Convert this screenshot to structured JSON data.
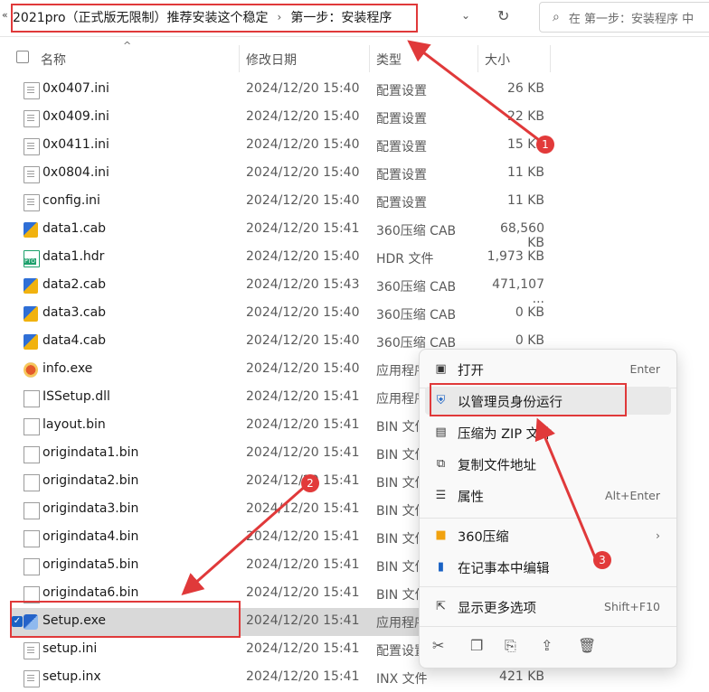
{
  "address": {
    "back_chevron": "«",
    "path": [
      "2021pro（正式版无限制）推荐安装这个稳定",
      "第一步：安装程序"
    ],
    "separator": "›",
    "dropdown": "⌄",
    "refresh": "↻",
    "search_placeholder": "在 第一步：安装程序 中"
  },
  "columns": {
    "name": "名称",
    "date": "修改日期",
    "type": "类型",
    "size": "大小"
  },
  "files": [
    {
      "name": "0x0407.ini",
      "date": "2024/12/20 15:40",
      "type": "配置设置",
      "size": "26 KB",
      "icon": "ini"
    },
    {
      "name": "0x0409.ini",
      "date": "2024/12/20 15:40",
      "type": "配置设置",
      "size": "22 KB",
      "icon": "ini"
    },
    {
      "name": "0x0411.ini",
      "date": "2024/12/20 15:40",
      "type": "配置设置",
      "size": "15 KB",
      "icon": "ini"
    },
    {
      "name": "0x0804.ini",
      "date": "2024/12/20 15:40",
      "type": "配置设置",
      "size": "11 KB",
      "icon": "ini"
    },
    {
      "name": "config.ini",
      "date": "2024/12/20 15:40",
      "type": "配置设置",
      "size": "11 KB",
      "icon": "ini"
    },
    {
      "name": "data1.cab",
      "date": "2024/12/20 15:41",
      "type": "360压缩 CAB ...",
      "size": "68,560 KB",
      "icon": "cab"
    },
    {
      "name": "data1.hdr",
      "date": "2024/12/20 15:40",
      "type": "HDR 文件",
      "size": "1,973 KB",
      "icon": "hdr"
    },
    {
      "name": "data2.cab",
      "date": "2024/12/20 15:43",
      "type": "360压缩 CAB ...",
      "size": "471,107 ...",
      "icon": "cab"
    },
    {
      "name": "data3.cab",
      "date": "2024/12/20 15:40",
      "type": "360压缩 CAB ...",
      "size": "0 KB",
      "icon": "cab"
    },
    {
      "name": "data4.cab",
      "date": "2024/12/20 15:40",
      "type": "360压缩 CAB ...",
      "size": "0 KB",
      "icon": "cab"
    },
    {
      "name": "info.exe",
      "date": "2024/12/20 15:40",
      "type": "应用程序",
      "size": "",
      "icon": "exe"
    },
    {
      "name": "ISSetup.dll",
      "date": "2024/12/20 15:41",
      "type": "应用程序",
      "size": "",
      "icon": "dll"
    },
    {
      "name": "layout.bin",
      "date": "2024/12/20 15:41",
      "type": "BIN 文件",
      "size": "",
      "icon": "bin"
    },
    {
      "name": "origindata1.bin",
      "date": "2024/12/20 15:41",
      "type": "BIN 文件",
      "size": "",
      "icon": "bin"
    },
    {
      "name": "origindata2.bin",
      "date": "2024/12/20 15:41",
      "type": "BIN 文件",
      "size": "",
      "icon": "bin"
    },
    {
      "name": "origindata3.bin",
      "date": "2024/12/20 15:41",
      "type": "BIN 文件",
      "size": "",
      "icon": "bin"
    },
    {
      "name": "origindata4.bin",
      "date": "2024/12/20 15:41",
      "type": "BIN 文件",
      "size": "",
      "icon": "bin"
    },
    {
      "name": "origindata5.bin",
      "date": "2024/12/20 15:41",
      "type": "BIN 文件",
      "size": "",
      "icon": "bin"
    },
    {
      "name": "origindata6.bin",
      "date": "2024/12/20 15:41",
      "type": "BIN 文件",
      "size": "",
      "icon": "bin"
    },
    {
      "name": "Setup.exe",
      "date": "2024/12/20 15:41",
      "type": "应用程序",
      "size": "",
      "icon": "setup",
      "selected": true
    },
    {
      "name": "setup.ini",
      "date": "2024/12/20 15:41",
      "type": "配置设置",
      "size": "",
      "icon": "ini"
    },
    {
      "name": "setup.inx",
      "date": "2024/12/20 15:41",
      "type": "INX 文件",
      "size": "421 KB",
      "icon": "ini"
    }
  ],
  "context_menu": {
    "items": [
      {
        "label": "打开",
        "shortcut": "Enter",
        "icon": "open-icon"
      },
      {
        "label": "以管理员身份运行",
        "shortcut": "",
        "icon": "shield-icon"
      },
      {
        "label": "压缩为 ZIP 文件",
        "shortcut": "",
        "icon": "zip-icon"
      },
      {
        "label": "复制文件地址",
        "shortcut": "",
        "icon": "copy-path-icon"
      },
      {
        "label": "属性",
        "shortcut": "Alt+Enter",
        "icon": "properties-icon"
      },
      {
        "label": "360压缩",
        "shortcut": "",
        "icon": "archive-icon",
        "submenu": "›"
      },
      {
        "label": "在记事本中编辑",
        "shortcut": "",
        "icon": "notepad-icon"
      },
      {
        "label": "显示更多选项",
        "shortcut": "Shift+F10",
        "icon": "more-options-icon"
      }
    ],
    "bottom_icons": [
      "cut-icon",
      "copy-icon",
      "rename-icon",
      "share-icon",
      "delete-icon"
    ]
  },
  "annotations": {
    "badges": [
      "1",
      "2",
      "3"
    ],
    "color": "#e0393a"
  }
}
